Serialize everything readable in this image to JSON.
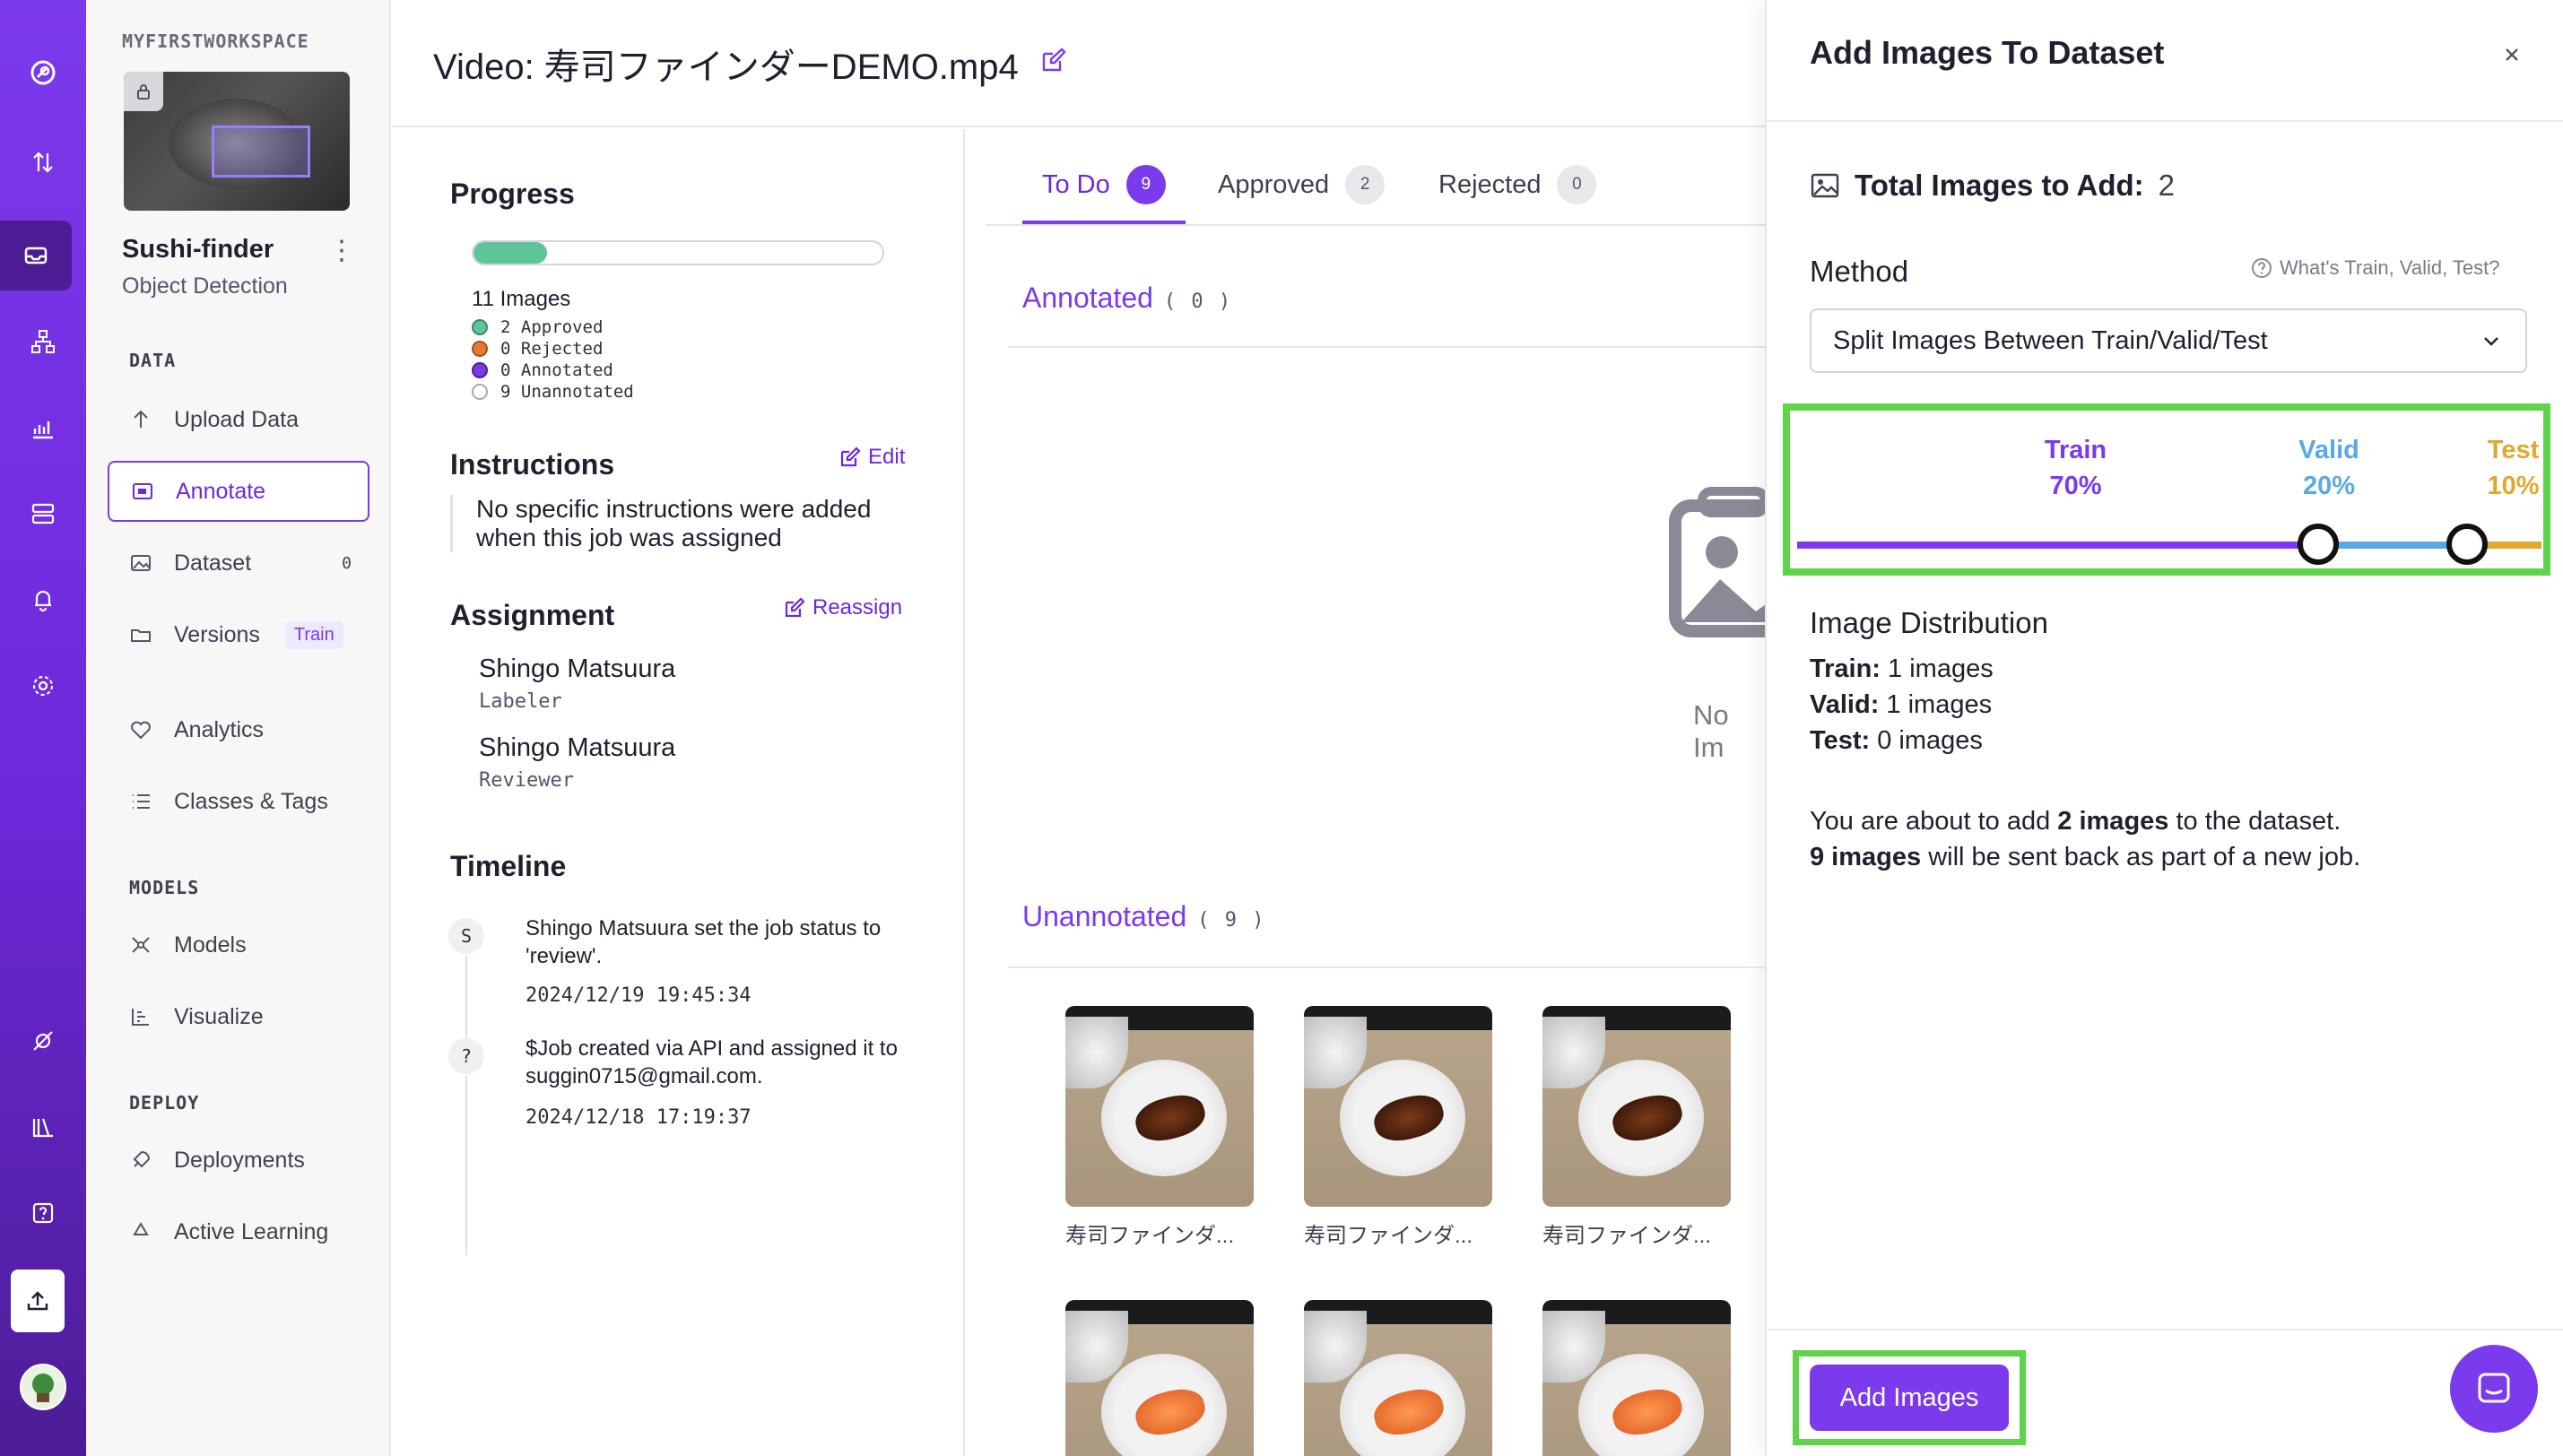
{
  "rail": {
    "icons": [
      "logo-icon",
      "sort-icon",
      "inbox-icon",
      "network-icon",
      "chart-icon",
      "server-icon",
      "bell-icon",
      "gear-icon",
      "satellite-icon",
      "books-icon",
      "help-icon",
      "upload-icon",
      "avatar"
    ]
  },
  "sidebar": {
    "workspace": "MYFIRSTWORKSPACE",
    "project_name": "Sushi-finder",
    "project_type": "Object Detection",
    "sections": {
      "data": "DATA",
      "models": "MODELS",
      "deploy": "DEPLOY"
    },
    "items": {
      "upload": "Upload Data",
      "annotate": "Annotate",
      "dataset": "Dataset",
      "dataset_count": "0",
      "versions": "Versions",
      "versions_tag": "Train",
      "analytics": "Analytics",
      "classes": "Classes & Tags",
      "models": "Models",
      "visualize": "Visualize",
      "deployments": "Deployments",
      "active_learning": "Active Learning"
    }
  },
  "header": {
    "title": "Video: 寿司ファインダーDEMO.mp4"
  },
  "job": {
    "progress_title": "Progress",
    "progress_fraction": 0.18,
    "images_count": "11 Images",
    "legend": {
      "approved": "2 Approved",
      "rejected": "0 Rejected",
      "annotated": "0 Annotated",
      "unannotated": "9 Unannotated"
    },
    "instructions_title": "Instructions",
    "edit_label": "Edit",
    "instructions_text": "No specific instructions were added when this job was assigned",
    "assignment_title": "Assignment",
    "reassign_label": "Reassign",
    "labeler_name": "Shingo Matsuura",
    "labeler_role": "Labeler",
    "reviewer_name": "Shingo Matsuura",
    "reviewer_role": "Reviewer",
    "timeline_title": "Timeline",
    "timeline": [
      {
        "avatar": "S",
        "text": "Shingo Matsuura set the job status to 'review'.",
        "time": "2024/12/19 19:45:34"
      },
      {
        "avatar": "?",
        "text": "$Job created via API and assigned it to suggin0715@gmail.com.",
        "time": "2024/12/18 17:19:37"
      }
    ]
  },
  "images": {
    "tabs": [
      {
        "label": "To Do",
        "count": "9"
      },
      {
        "label": "Approved",
        "count": "2"
      },
      {
        "label": "Rejected",
        "count": "0"
      }
    ],
    "annotated_title": "Annotated",
    "annotated_count": "( 0 )",
    "no_images_text": "No Im",
    "unannotated_title": "Unannotated",
    "unannotated_count": "( 9 )",
    "tile_caption": "寿司ファインダ..."
  },
  "dialog": {
    "title": "Add Images To Dataset",
    "total_label": "Total Images to Add:",
    "total_value": "2",
    "method_label": "Method",
    "whats_link": "What's Train, Valid, Test?",
    "method_value": "Split Images Between Train/Valid/Test",
    "split": {
      "train_label": "Train",
      "train_pct": "70%",
      "train_value": 70,
      "valid_label": "Valid",
      "valid_pct": "20%",
      "valid_value": 20,
      "test_label": "Test",
      "test_pct": "10%",
      "test_value": 10
    },
    "colors": {
      "train": "#7c3aed",
      "valid": "#5aa9e6",
      "test": "#e0a82e",
      "highlight": "#5fd44a"
    },
    "distribution_title": "Image Distribution",
    "dist_train_label": "Train:",
    "dist_train_value": "1 images",
    "dist_valid_label": "Valid:",
    "dist_valid_value": "1 images",
    "dist_test_label": "Test:",
    "dist_test_value": "0 images",
    "about_1": "You are about to add ",
    "about_2": "2 images",
    "about_3": " to the dataset.",
    "about_4": "9 images",
    "about_5": " will be sent back as part of a new job.",
    "add_button": "Add Images"
  }
}
